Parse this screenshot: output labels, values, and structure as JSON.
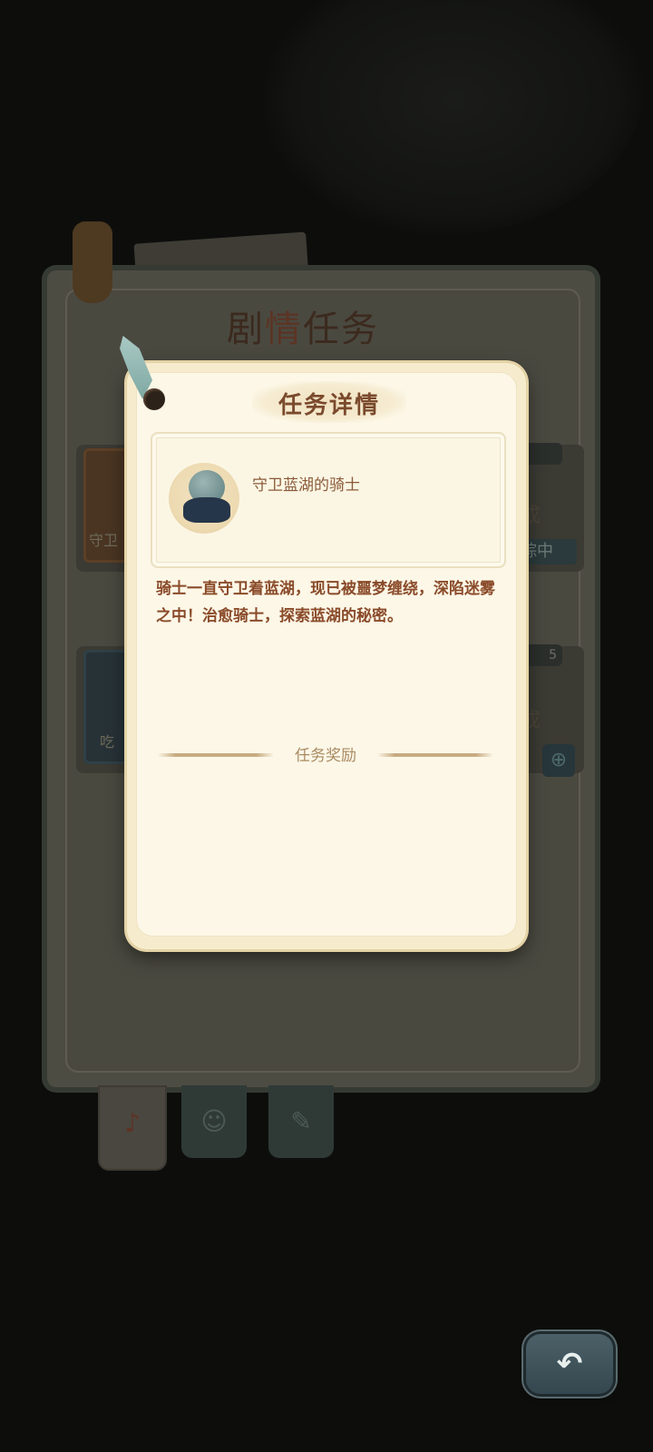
{
  "background": {
    "board_title_part1": "剧",
    "board_title_part2": "情",
    "board_title_part3": "任务",
    "task1_label": "守卫",
    "task1_status": "成",
    "task1_track": "踪中",
    "task2_label": "吃",
    "task2_badge": "5",
    "task2_status": "成"
  },
  "modal": {
    "title": "任务详情",
    "task_name": "守卫蓝湖的骑士",
    "description": "骑士一直守卫着蓝湖，现已被噩梦缠绕，深陷迷雾之中！治愈骑士，探索蓝湖的秘密。",
    "reward_label": "任务奖励"
  },
  "icons": {
    "back": "undo-arrow-icon"
  },
  "colors": {
    "modal_bg": "#fcf7e7",
    "title_text": "#7b4a2d",
    "desc_text": "#8a4b2a",
    "back_button": "#3e535b"
  }
}
